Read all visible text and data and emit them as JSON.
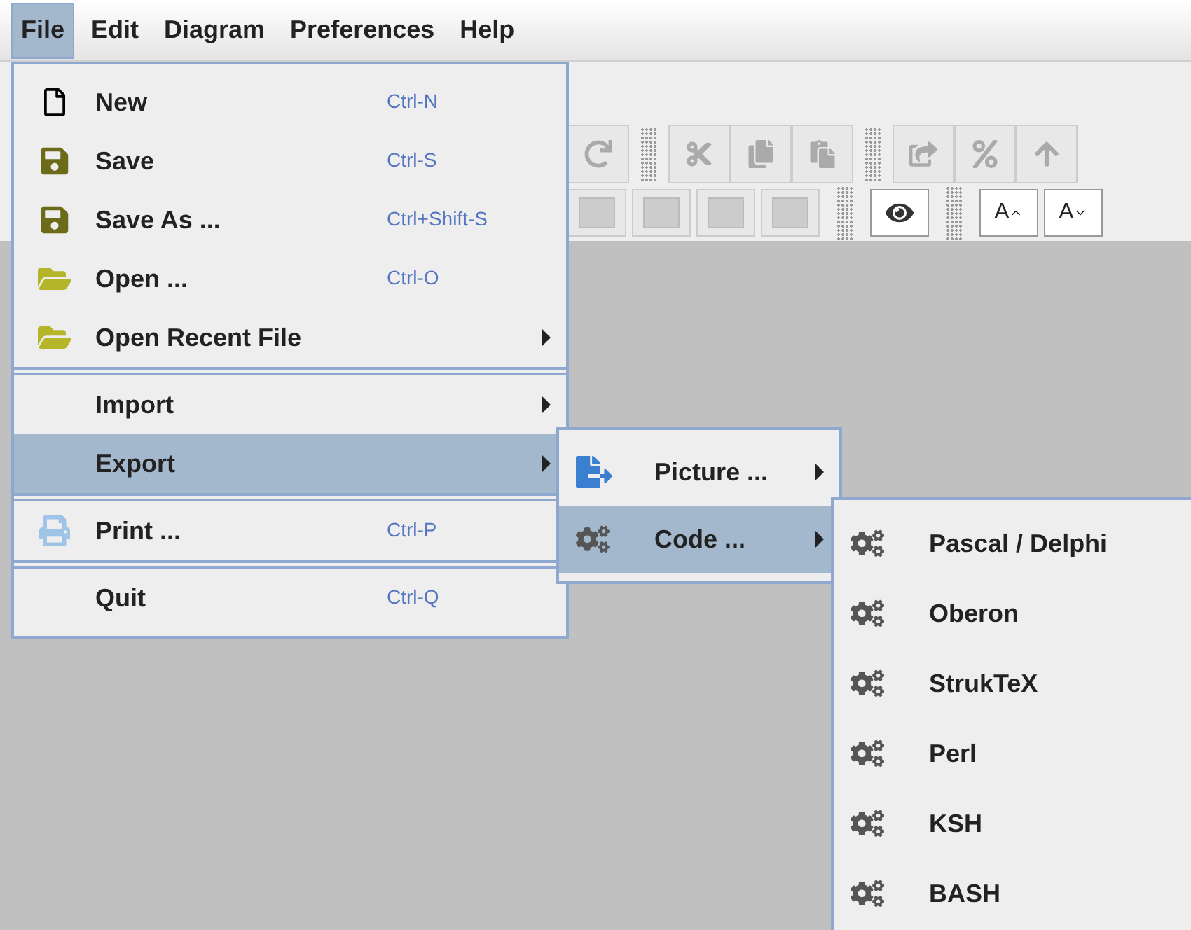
{
  "menubar": [
    {
      "label": "File",
      "selected": true
    },
    {
      "label": "Edit",
      "selected": false
    },
    {
      "label": "Diagram",
      "selected": false
    },
    {
      "label": "Preferences",
      "selected": false
    },
    {
      "label": "Help",
      "selected": false
    }
  ],
  "toolbar": {
    "font_buttons": [
      {
        "label": "A",
        "kind": "grow"
      },
      {
        "label": "A",
        "kind": "shrink"
      }
    ]
  },
  "file_menu": {
    "items": [
      {
        "kind": "item",
        "label": "New",
        "shortcut": "Ctrl-N",
        "submenu": false,
        "selected": false
      },
      {
        "kind": "item",
        "label": "Save",
        "shortcut": "Ctrl-S",
        "submenu": false,
        "selected": false
      },
      {
        "kind": "item",
        "label": "Save As ...",
        "shortcut": "Ctrl+Shift-S",
        "submenu": false,
        "selected": false
      },
      {
        "kind": "item",
        "label": "Open ...",
        "shortcut": "Ctrl-O",
        "submenu": false,
        "selected": false
      },
      {
        "kind": "item",
        "label": "Open Recent File",
        "submenu": true,
        "selected": false
      },
      {
        "kind": "separator"
      },
      {
        "kind": "item",
        "label": "Import",
        "submenu": true,
        "selected": false
      },
      {
        "kind": "item",
        "label": "Export",
        "submenu": true,
        "selected": true
      },
      {
        "kind": "separator"
      },
      {
        "kind": "item",
        "label": "Print ...",
        "shortcut": "Ctrl-P",
        "submenu": false,
        "selected": false
      },
      {
        "kind": "separator"
      },
      {
        "kind": "item",
        "label": "Quit",
        "shortcut": "Ctrl-Q",
        "submenu": false,
        "selected": false
      }
    ]
  },
  "export_menu": {
    "items": [
      {
        "label": "Picture ...",
        "submenu": true,
        "selected": false
      },
      {
        "label": "Code ...",
        "submenu": true,
        "selected": true
      }
    ]
  },
  "code_menu": {
    "items": [
      {
        "label": "Pascal / Delphi",
        "selected": false
      },
      {
        "label": "Oberon",
        "selected": false
      },
      {
        "label": "StrukTeX",
        "selected": false
      },
      {
        "label": "Perl",
        "selected": false
      },
      {
        "label": "KSH",
        "selected": false
      },
      {
        "label": "BASH",
        "selected": false
      }
    ]
  }
}
